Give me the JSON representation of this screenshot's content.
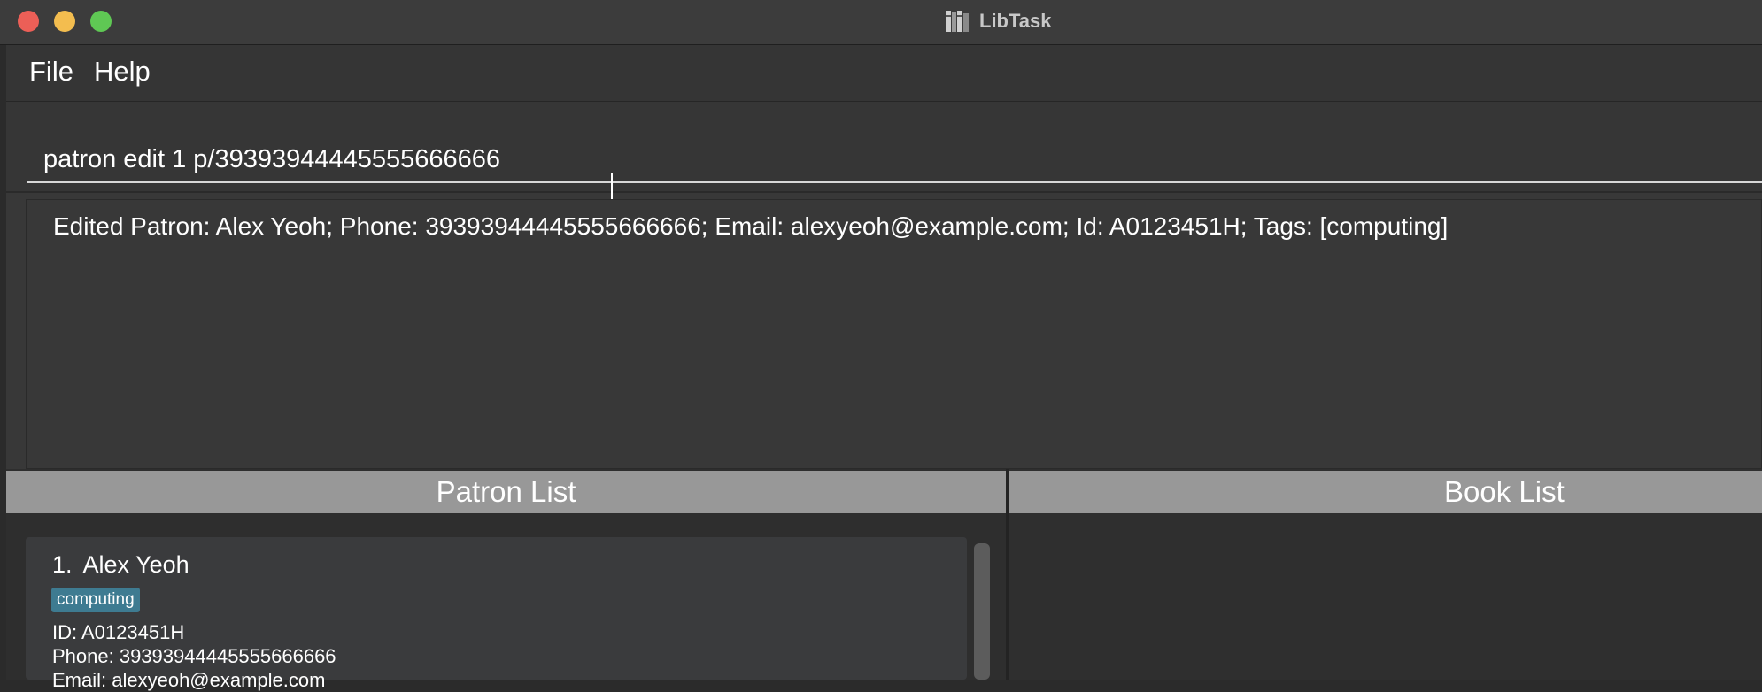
{
  "window": {
    "title": "LibTask"
  },
  "menu": {
    "items": [
      "File",
      "Help"
    ]
  },
  "command": {
    "value": "patron edit 1 p/39393944445555666666"
  },
  "result": {
    "message": "Edited Patron: Alex Yeoh; Phone: 39393944445555666666; Email: alexyeoh@example.com; Id: A0123451H; Tags: [computing]"
  },
  "patron_list": {
    "header": "Patron List",
    "items": [
      {
        "index": "1.",
        "name": "Alex Yeoh",
        "tag": "computing",
        "id_line": "ID: A0123451H",
        "phone_line": "Phone: 39393944445555666666",
        "email_line": "Email: alexyeoh@example.com"
      }
    ]
  },
  "book_list": {
    "header": "Book List"
  },
  "colors": {
    "tag": "#3e7b91",
    "header": "#989898",
    "background": "#383838"
  }
}
